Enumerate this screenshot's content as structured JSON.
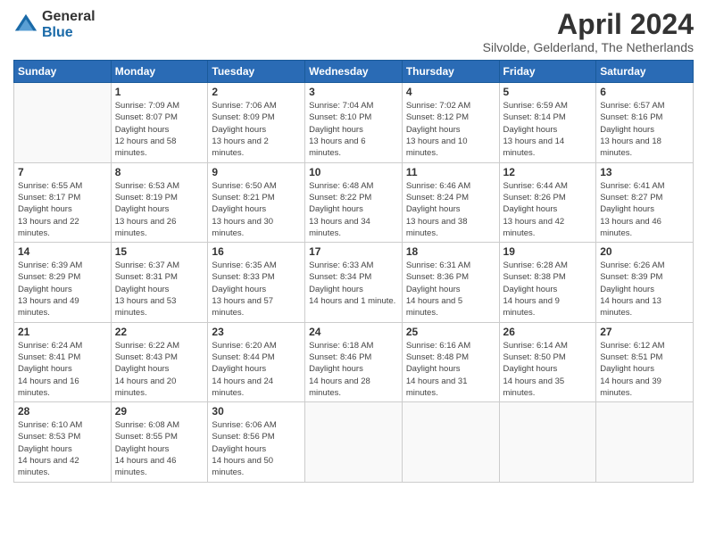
{
  "header": {
    "logo_general": "General",
    "logo_blue": "Blue",
    "month_title": "April 2024",
    "location": "Silvolde, Gelderland, The Netherlands"
  },
  "weekdays": [
    "Sunday",
    "Monday",
    "Tuesday",
    "Wednesday",
    "Thursday",
    "Friday",
    "Saturday"
  ],
  "weeks": [
    [
      {
        "day": "",
        "empty": true
      },
      {
        "day": "1",
        "sunrise": "7:09 AM",
        "sunset": "8:07 PM",
        "daylight": "12 hours and 58 minutes."
      },
      {
        "day": "2",
        "sunrise": "7:06 AM",
        "sunset": "8:09 PM",
        "daylight": "13 hours and 2 minutes."
      },
      {
        "day": "3",
        "sunrise": "7:04 AM",
        "sunset": "8:10 PM",
        "daylight": "13 hours and 6 minutes."
      },
      {
        "day": "4",
        "sunrise": "7:02 AM",
        "sunset": "8:12 PM",
        "daylight": "13 hours and 10 minutes."
      },
      {
        "day": "5",
        "sunrise": "6:59 AM",
        "sunset": "8:14 PM",
        "daylight": "13 hours and 14 minutes."
      },
      {
        "day": "6",
        "sunrise": "6:57 AM",
        "sunset": "8:16 PM",
        "daylight": "13 hours and 18 minutes."
      }
    ],
    [
      {
        "day": "7",
        "sunrise": "6:55 AM",
        "sunset": "8:17 PM",
        "daylight": "13 hours and 22 minutes."
      },
      {
        "day": "8",
        "sunrise": "6:53 AM",
        "sunset": "8:19 PM",
        "daylight": "13 hours and 26 minutes."
      },
      {
        "day": "9",
        "sunrise": "6:50 AM",
        "sunset": "8:21 PM",
        "daylight": "13 hours and 30 minutes."
      },
      {
        "day": "10",
        "sunrise": "6:48 AM",
        "sunset": "8:22 PM",
        "daylight": "13 hours and 34 minutes."
      },
      {
        "day": "11",
        "sunrise": "6:46 AM",
        "sunset": "8:24 PM",
        "daylight": "13 hours and 38 minutes."
      },
      {
        "day": "12",
        "sunrise": "6:44 AM",
        "sunset": "8:26 PM",
        "daylight": "13 hours and 42 minutes."
      },
      {
        "day": "13",
        "sunrise": "6:41 AM",
        "sunset": "8:27 PM",
        "daylight": "13 hours and 46 minutes."
      }
    ],
    [
      {
        "day": "14",
        "sunrise": "6:39 AM",
        "sunset": "8:29 PM",
        "daylight": "13 hours and 49 minutes."
      },
      {
        "day": "15",
        "sunrise": "6:37 AM",
        "sunset": "8:31 PM",
        "daylight": "13 hours and 53 minutes."
      },
      {
        "day": "16",
        "sunrise": "6:35 AM",
        "sunset": "8:33 PM",
        "daylight": "13 hours and 57 minutes."
      },
      {
        "day": "17",
        "sunrise": "6:33 AM",
        "sunset": "8:34 PM",
        "daylight": "14 hours and 1 minute."
      },
      {
        "day": "18",
        "sunrise": "6:31 AM",
        "sunset": "8:36 PM",
        "daylight": "14 hours and 5 minutes."
      },
      {
        "day": "19",
        "sunrise": "6:28 AM",
        "sunset": "8:38 PM",
        "daylight": "14 hours and 9 minutes."
      },
      {
        "day": "20",
        "sunrise": "6:26 AM",
        "sunset": "8:39 PM",
        "daylight": "14 hours and 13 minutes."
      }
    ],
    [
      {
        "day": "21",
        "sunrise": "6:24 AM",
        "sunset": "8:41 PM",
        "daylight": "14 hours and 16 minutes."
      },
      {
        "day": "22",
        "sunrise": "6:22 AM",
        "sunset": "8:43 PM",
        "daylight": "14 hours and 20 minutes."
      },
      {
        "day": "23",
        "sunrise": "6:20 AM",
        "sunset": "8:44 PM",
        "daylight": "14 hours and 24 minutes."
      },
      {
        "day": "24",
        "sunrise": "6:18 AM",
        "sunset": "8:46 PM",
        "daylight": "14 hours and 28 minutes."
      },
      {
        "day": "25",
        "sunrise": "6:16 AM",
        "sunset": "8:48 PM",
        "daylight": "14 hours and 31 minutes."
      },
      {
        "day": "26",
        "sunrise": "6:14 AM",
        "sunset": "8:50 PM",
        "daylight": "14 hours and 35 minutes."
      },
      {
        "day": "27",
        "sunrise": "6:12 AM",
        "sunset": "8:51 PM",
        "daylight": "14 hours and 39 minutes."
      }
    ],
    [
      {
        "day": "28",
        "sunrise": "6:10 AM",
        "sunset": "8:53 PM",
        "daylight": "14 hours and 42 minutes."
      },
      {
        "day": "29",
        "sunrise": "6:08 AM",
        "sunset": "8:55 PM",
        "daylight": "14 hours and 46 minutes."
      },
      {
        "day": "30",
        "sunrise": "6:06 AM",
        "sunset": "8:56 PM",
        "daylight": "14 hours and 50 minutes."
      },
      {
        "day": "",
        "empty": true
      },
      {
        "day": "",
        "empty": true
      },
      {
        "day": "",
        "empty": true
      },
      {
        "day": "",
        "empty": true
      }
    ]
  ],
  "labels": {
    "sunrise": "Sunrise:",
    "sunset": "Sunset:",
    "daylight": "Daylight hours"
  }
}
